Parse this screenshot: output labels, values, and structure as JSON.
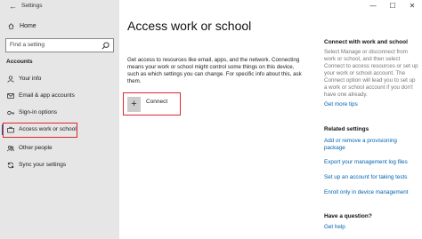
{
  "window": {
    "title": "Settings",
    "back_glyph": "←",
    "minimize": "—",
    "maximize": "☐",
    "close": "✕"
  },
  "sidebar": {
    "home_label": "Home",
    "search_placeholder": "Find a setting",
    "section_label": "Accounts",
    "items": [
      {
        "label": "Your info",
        "icon": "person-icon"
      },
      {
        "label": "Email & app accounts",
        "icon": "mail-icon"
      },
      {
        "label": "Sign-in options",
        "icon": "key-icon"
      },
      {
        "label": "Access work or school",
        "icon": "briefcase-icon",
        "active": true
      },
      {
        "label": "Other people",
        "icon": "people-icon"
      },
      {
        "label": "Sync your settings",
        "icon": "sync-icon"
      }
    ]
  },
  "main": {
    "title": "Access work or school",
    "description": "Get access to resources like email, apps, and the network. Connecting means your work or school might control some things on this device, such as which settings you can change. For specific info about this, ask them.",
    "connect_label": "Connect",
    "connect_glyph": "+"
  },
  "right_panel": {
    "connect_heading": "Connect with work and school",
    "connect_text": "Select Manage or disconnect from work or school, and then select Connect to access resources or set up your work or school account. The Connect option will lead you to set up a work or school account if you don't have one already.",
    "more_tips": "Get more tips",
    "related_heading": "Related settings",
    "related_links": [
      "Add or remove a provisioning package",
      "Export your management log files",
      "Set up an account for taking tests",
      "Enroll only in device management"
    ],
    "question_heading": "Have a question?",
    "get_help": "Get help"
  },
  "colors": {
    "accent": "#0063b1",
    "highlight_box": "#e0252d",
    "sidebar_bg": "#e6e6e6"
  }
}
